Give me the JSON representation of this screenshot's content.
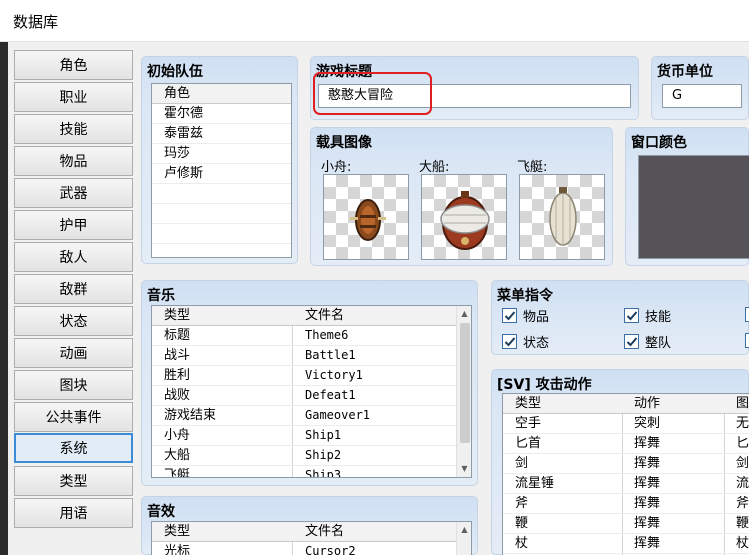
{
  "window": {
    "title": "数据库"
  },
  "sidebar": {
    "items": [
      {
        "label": "角色"
      },
      {
        "label": "职业"
      },
      {
        "label": "技能"
      },
      {
        "label": "物品"
      },
      {
        "label": "武器"
      },
      {
        "label": "护甲"
      },
      {
        "label": "敌人"
      },
      {
        "label": "敌群"
      },
      {
        "label": "状态"
      },
      {
        "label": "动画"
      },
      {
        "label": "图块"
      },
      {
        "label": "公共事件"
      },
      {
        "label": "系统"
      },
      {
        "label": "类型"
      },
      {
        "label": "用语"
      }
    ],
    "active": "系统"
  },
  "party": {
    "title": "初始队伍",
    "header": "角色",
    "members": [
      "霍尔德",
      "泰雷兹",
      "玛莎",
      "卢修斯"
    ]
  },
  "game_title": {
    "label": "游戏标题",
    "value": "憨憨大冒险"
  },
  "currency": {
    "label": "货币单位",
    "value": "G"
  },
  "vehicles": {
    "title": "载具图像",
    "boat_label": "小舟:",
    "ship_label": "大船:",
    "airship_label": "飞艇:"
  },
  "window_color": {
    "title": "窗口颜色",
    "color": "#555357"
  },
  "music": {
    "title": "音乐",
    "headers": [
      "类型",
      "文件名"
    ],
    "rows": [
      [
        "标题",
        "Theme6"
      ],
      [
        "战斗",
        "Battle1"
      ],
      [
        "胜利",
        "Victory1"
      ],
      [
        "战败",
        "Defeat1"
      ],
      [
        "游戏结束",
        "Gameover1"
      ],
      [
        "小舟",
        "Ship1"
      ],
      [
        "大船",
        "Ship2"
      ],
      [
        "飞艇",
        "Ship3"
      ]
    ]
  },
  "sound": {
    "title": "音效",
    "headers": [
      "类型",
      "文件名"
    ],
    "rows": [
      [
        "光标",
        "Cursor2"
      ]
    ]
  },
  "menu_commands": {
    "title": "菜单指令",
    "items": [
      {
        "label": "物品",
        "checked": true
      },
      {
        "label": "技能",
        "checked": true
      },
      {
        "label": "状态",
        "checked": true
      },
      {
        "label": "整队",
        "checked": true
      }
    ]
  },
  "sv_attack": {
    "title": "[SV] 攻击动作",
    "headers": [
      "类型",
      "动作",
      "图"
    ],
    "rows": [
      [
        "空手",
        "突刺",
        "无"
      ],
      [
        "匕首",
        "挥舞",
        "匕"
      ],
      [
        "剑",
        "挥舞",
        "剑"
      ],
      [
        "流星锤",
        "挥舞",
        "流"
      ],
      [
        "斧",
        "挥舞",
        "斧"
      ],
      [
        "鞭",
        "挥舞",
        "鞭"
      ],
      [
        "杖",
        "挥舞",
        "杖"
      ]
    ]
  },
  "colors": {
    "accent": "#3c8bd6",
    "highlight": "#e02020",
    "panel": "#dbe7f5"
  }
}
